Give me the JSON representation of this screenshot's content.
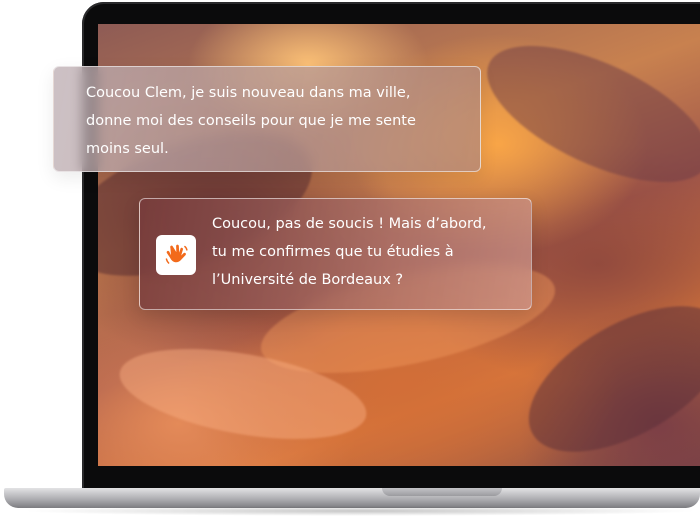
{
  "chat": {
    "messages": [
      {
        "sender": "user",
        "text": "Coucou Clem, je suis nouveau dans ma ville,\ndonne moi des conseils pour que je me sente\nmoins seul."
      },
      {
        "sender": "assistant",
        "avatar_icon": "waving-hand-icon",
        "text": "Coucou, pas de soucis ! Mais d’abord,\ntu me confirmes que tu étudies à\nl’Université de Bordeaux ?"
      }
    ]
  },
  "colors": {
    "hand": "#f26a1b",
    "bubble_border": "#ffffff"
  }
}
